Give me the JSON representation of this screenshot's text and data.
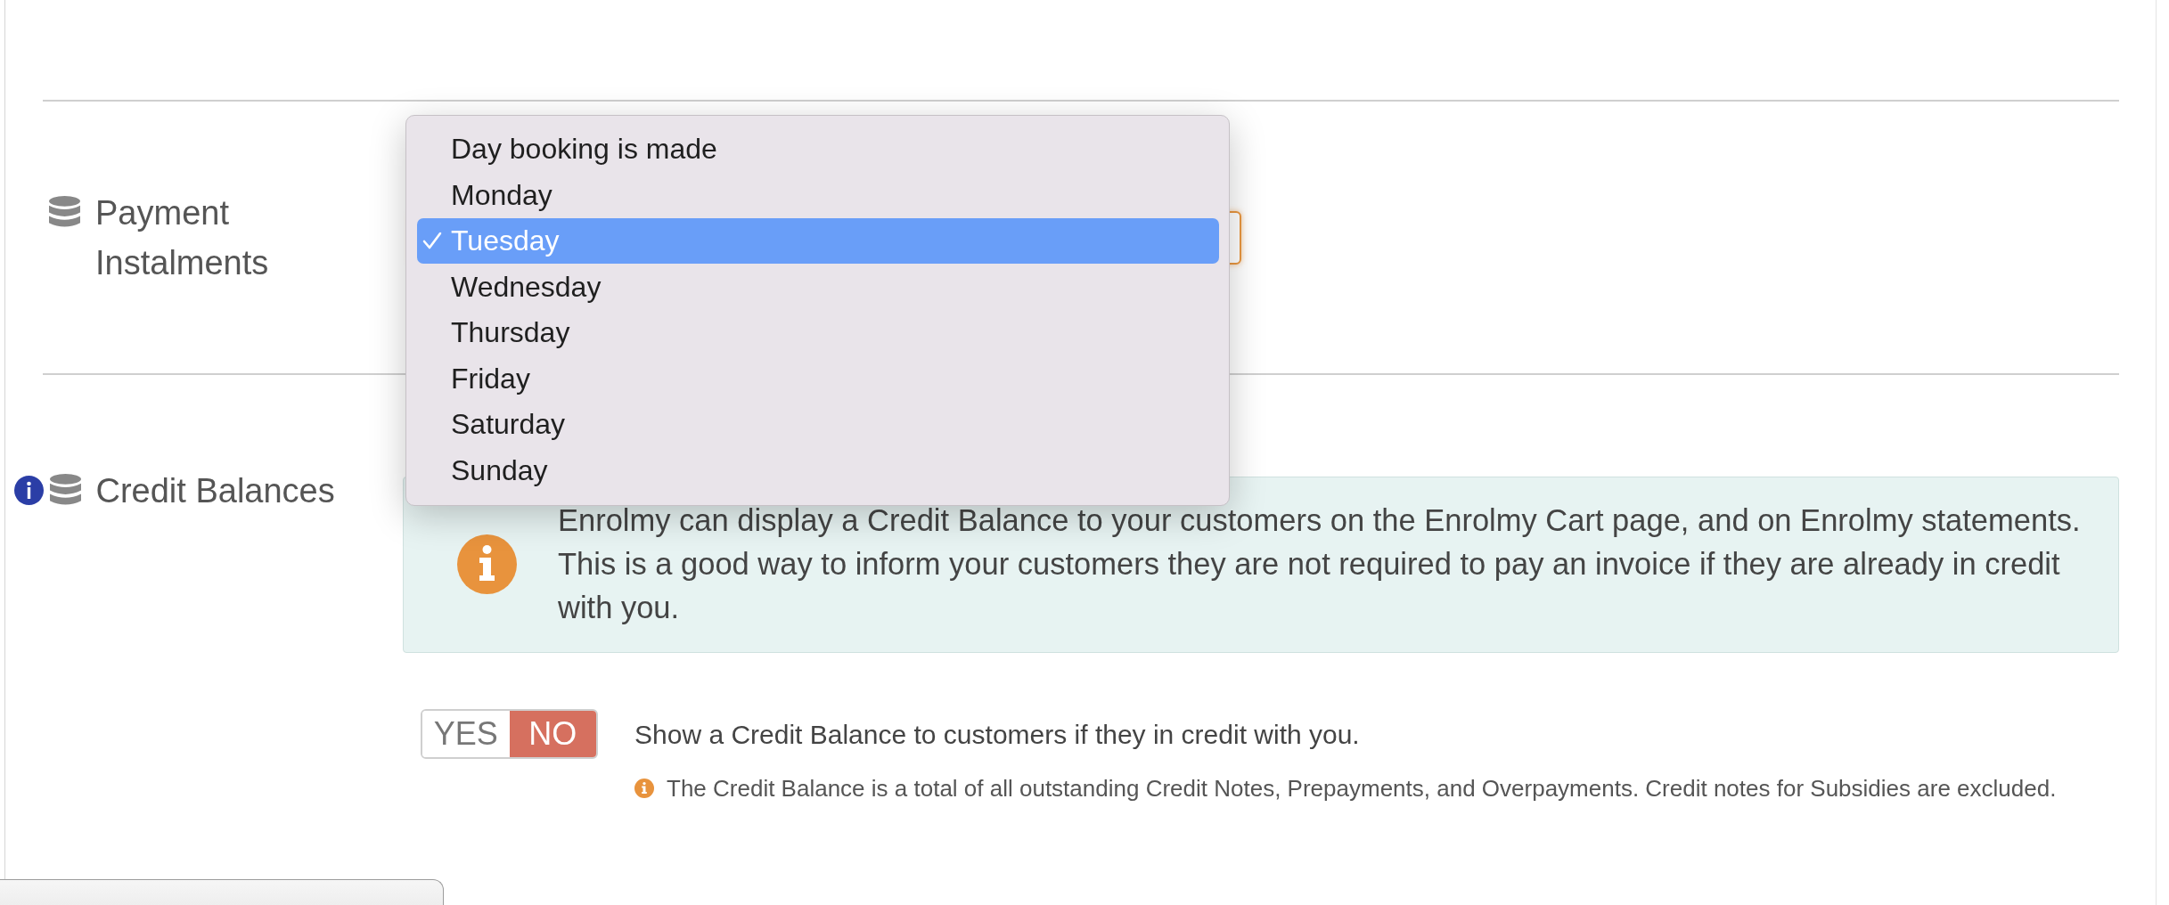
{
  "sections": [
    {
      "kind": "select",
      "label": "Payment Instalments",
      "info": false,
      "select": {
        "focused": true,
        "open": true,
        "options": [
          {
            "label": "Day booking is made",
            "selected": false
          },
          {
            "label": "Monday",
            "selected": false
          },
          {
            "label": "Tuesday",
            "selected": true
          },
          {
            "label": "Wednesday",
            "selected": false
          },
          {
            "label": "Thursday",
            "selected": false
          },
          {
            "label": "Friday",
            "selected": false
          },
          {
            "label": "Saturday",
            "selected": false
          },
          {
            "label": "Sunday",
            "selected": false
          }
        ]
      }
    },
    {
      "kind": "toggle",
      "label": "Credit Balances",
      "info": true,
      "notice": "Enrolmy can display a Credit Balance to your customers on the Enrolmy Cart page, and on Enrolmy statements. This is a good way to inform your customers they are not required to pay an invoice if they are already in credit with you.",
      "toggle": {
        "options": [
          {
            "label": "YES",
            "selected": false
          },
          {
            "label": "NO",
            "selected": true
          }
        ]
      },
      "description": "Show a Credit Balance to customers if they in credit with you.",
      "hint": "The Credit Balance is a total of all outstanding Credit Notes, Prepayments, and Overpayments. Credit notes for Subsidies are excluded."
    }
  ]
}
